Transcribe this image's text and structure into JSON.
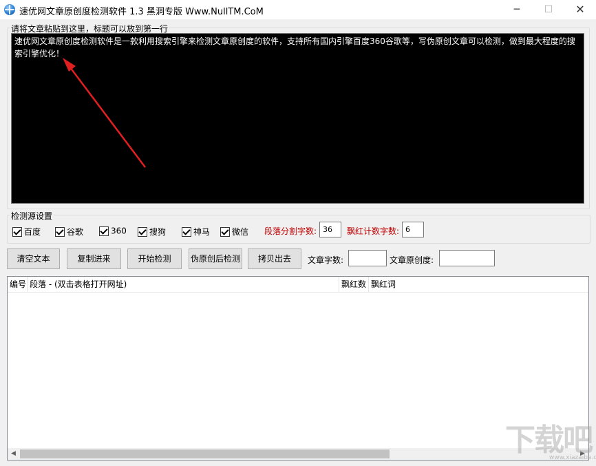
{
  "window": {
    "title": "速优网文章原创度检测软件 1.3   黑洞专版 Www.NullTM.CoM",
    "minimize_glyph": "─",
    "maximize_glyph": "☐",
    "close_glyph": "✕"
  },
  "editor": {
    "group_label": "请将文章粘贴到这里，标题可以放到第一行",
    "content": "速优网文章原创度检测软件是一款利用搜索引擎来检测文章原创度的软件，支持所有国内引擎百度360谷歌等，写伪原创文章可以检测，做到最大程度的搜索引擎优化！"
  },
  "sources": {
    "group_label": "检测源设置",
    "items": [
      {
        "label": "百度",
        "checked": true
      },
      {
        "label": "谷歌",
        "checked": true
      },
      {
        "label": "360",
        "checked": true
      },
      {
        "label": "搜狗",
        "checked": true
      },
      {
        "label": "神马",
        "checked": true
      },
      {
        "label": "微信",
        "checked": true
      }
    ],
    "segment_label": "段落分割字数:",
    "segment_value": "36",
    "red_count_label": "飘红计数字数:",
    "red_count_value": "6"
  },
  "toolbar": {
    "clear_label": "清空文本",
    "paste_label": "复制进来",
    "start_label": "开始检测",
    "pseudo_label": "伪原创后检测",
    "copy_out_label": "拷贝出去",
    "word_count_label": "文章字数:",
    "word_count_value": "",
    "originality_label": "文章原创度:",
    "originality_value": ""
  },
  "table": {
    "columns": [
      "编号",
      "段落 - (双击表格打开网址)",
      "飘红数",
      "飘红词"
    ],
    "rows": []
  },
  "watermark": {
    "text": "下载吧",
    "sub": "www.xiazaiba.com"
  },
  "colors": {
    "editor_bg": "#000000",
    "red_label": "#c00000",
    "arrow": "#e02020"
  }
}
